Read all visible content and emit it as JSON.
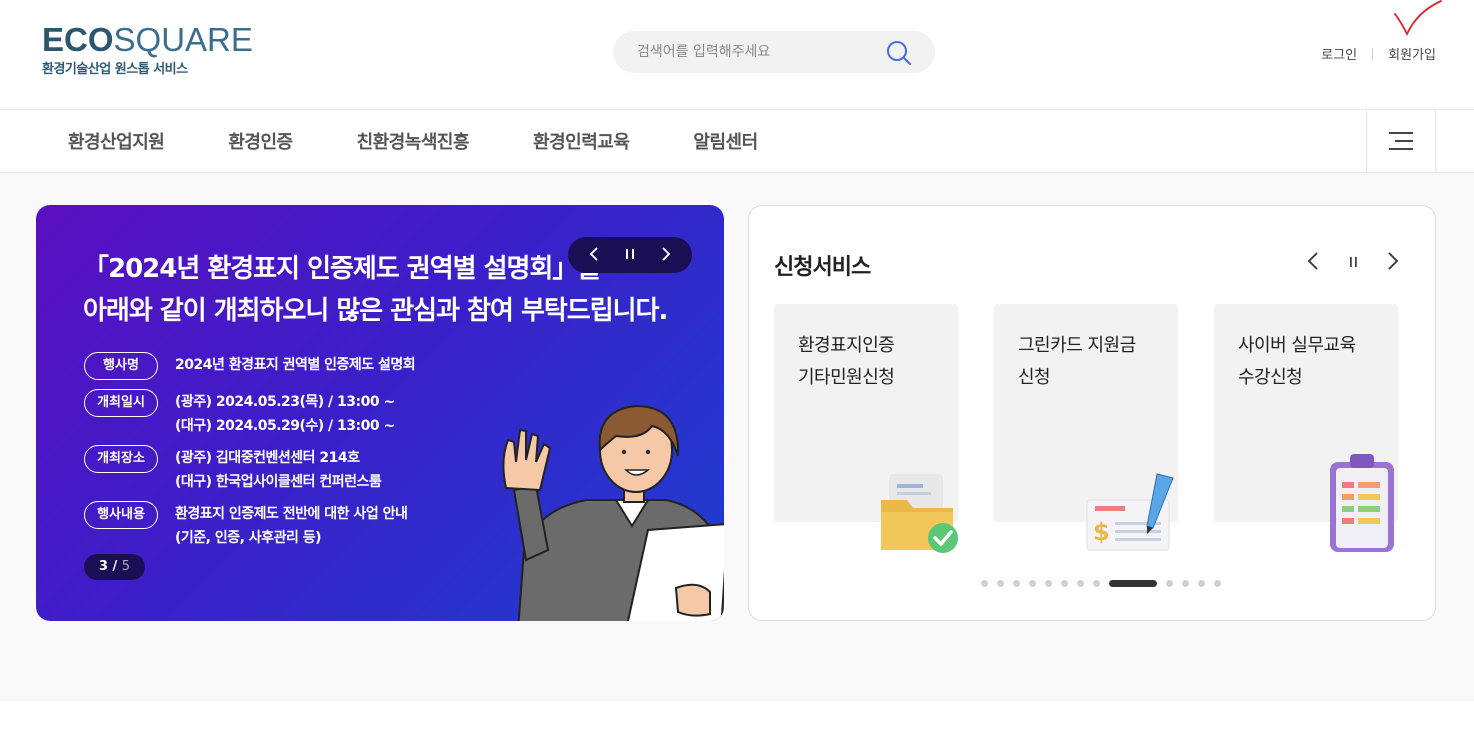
{
  "header": {
    "logo_bold": "ECO",
    "logo_light": "SQUARE",
    "logo_sub": "환경기술산업 원스톱 서비스",
    "search_placeholder": "검색어를 입력해주세요",
    "login": "로그인",
    "signup": "회원가입"
  },
  "nav": {
    "items": [
      "환경산업지원",
      "환경인증",
      "친환경녹색진흥",
      "환경인력교육",
      "알림센터"
    ]
  },
  "banner": {
    "title_line1": "「2024년 환경표지 인증제도 권역별 설명회」를",
    "title_line2": "아래와 같이 개최하오니 많은 관심과 참여 부탁드립니다.",
    "rows": [
      {
        "label": "행사명",
        "lines": [
          "2024년 환경표지 권역별 인증제도 설명회"
        ]
      },
      {
        "label": "개최일시",
        "lines": [
          "(광주) 2024.05.23(목) / 13:00 ~",
          "(대구) 2024.05.29(수) / 13:00 ~"
        ]
      },
      {
        "label": "개최장소",
        "lines": [
          "(광주) 김대중컨벤션센터 214호",
          "(대구) 한국업사이클센터 컨퍼런스룸"
        ]
      },
      {
        "label": "행사내용",
        "lines": [
          "환경표지 인증제도 전반에 대한 사업 안내",
          "(기준, 인증, 사후관리 등)"
        ]
      }
    ],
    "pager_current": "3",
    "pager_sep": " / ",
    "pager_total": "5",
    "icons": {
      "prev": "chevron-left-icon",
      "pause": "pause-icon",
      "next": "chevron-right-icon"
    }
  },
  "service": {
    "title": "신청서비스",
    "cards": [
      {
        "line1": "환경표지인증",
        "line2": "기타민원신청",
        "icon": "folder-check-icon"
      },
      {
        "line1": "그린카드 지원금",
        "line2": "신청",
        "icon": "check-pen-icon"
      },
      {
        "line1": "사이버 실무교육",
        "line2": "수강신청",
        "icon": "clipboard-icon"
      }
    ],
    "dots_total": 13,
    "dots_active_index": 8
  },
  "colors": {
    "brand": "#2e5b74",
    "banner_start": "#5a0fc0",
    "banner_end": "#1d3fcf",
    "pager_bg": "#1a0f55"
  }
}
